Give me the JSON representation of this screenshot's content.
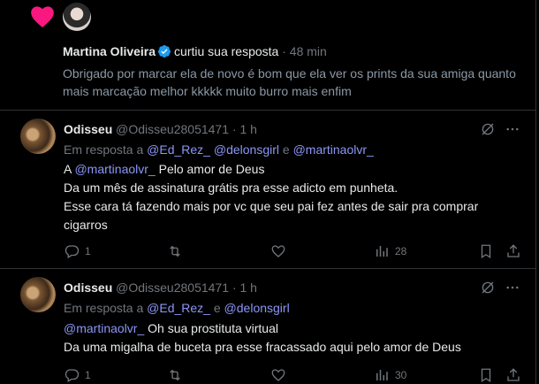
{
  "notification": {
    "icon": "heart-icon",
    "user_name": "Martina Oliveira",
    "action": "curtiu sua resposta",
    "separator": "·",
    "time": "48 min",
    "text": "Obrigado por marcar ela de novo é bom que ela ver os prints da sua amiga quanto mais marcação melhor kkkkk muito burro mais enfim"
  },
  "tweets": [
    {
      "display_name": "Odisseu",
      "handle": "@Odisseu28051471",
      "separator": "·",
      "time": "1 h",
      "replying_prefix": "Em resposta a",
      "replying_to": [
        "@Ed_Rez_",
        "@delonsgirl",
        "@martinaolvr_"
      ],
      "replying_sep1": " ",
      "replying_and": "e",
      "line1_prefix": "A",
      "line1_mention": "@martinaolvr_",
      "line1_suffix": "Pelo amor de Deus",
      "lines": [
        "Da um mês de assinatura grátis pra esse adicto em punheta.",
        "Esse cara tá fazendo mais por vc que seu pai fez antes de sair pra comprar",
        "cigarros"
      ],
      "replies": "1",
      "retweets": "",
      "likes": "",
      "views": "28"
    },
    {
      "display_name": "Odisseu",
      "handle": "@Odisseu28051471",
      "separator": "·",
      "time": "1 h",
      "replying_prefix": "Em resposta a",
      "replying_to": [
        "@Ed_Rez_",
        "@delonsgirl"
      ],
      "replying_and": "e",
      "line1_mention": "@martinaolvr_",
      "line1_suffix": "Oh sua prostituta virtual",
      "lines": [
        "Da uma migalha de buceta pra esse fracassado aqui pelo amor de Deus"
      ],
      "replies": "1",
      "views": "30"
    }
  ],
  "colors": {
    "background": "#000000",
    "text": "#e7e9ea",
    "muted": "#71767b",
    "mention": "#8c96f7",
    "heart": "#f91880",
    "verified": "#1d9bf0"
  }
}
